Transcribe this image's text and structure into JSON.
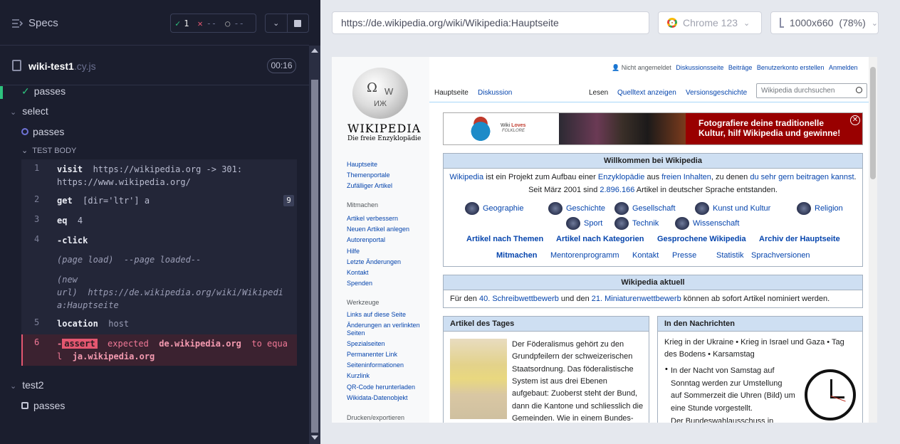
{
  "left": {
    "specs_label": "Specs",
    "stats": {
      "passed": "1",
      "failed": "--",
      "pending": "--"
    },
    "file": {
      "name": "wiki-test1",
      "ext": ".cy.js",
      "duration": "00:16"
    },
    "tests": [
      {
        "label": "passes"
      },
      {
        "label": "select"
      },
      {
        "label": "passes"
      },
      {
        "label": "TEST BODY"
      },
      {
        "label": "test2"
      },
      {
        "label": "passes"
      }
    ],
    "commands": [
      {
        "n": "1",
        "name": "visit",
        "msg": "https://wikipedia.org -> 301:\nhttps://www.wikipedia.org/"
      },
      {
        "n": "2",
        "name": "get",
        "msg": "[dir='ltr'] a",
        "badge": "9"
      },
      {
        "n": "3",
        "name": "eq",
        "msg": "4"
      },
      {
        "n": "4",
        "name": "-click",
        "msg": ""
      },
      {
        "n": "",
        "name": "(page load)",
        "msg": "--page loaded--"
      },
      {
        "n": "",
        "name": "(new\nurl)",
        "msg": "https://de.wikipedia.org/wiki/Wikipedia:Hauptseite"
      },
      {
        "n": "5",
        "name": "location",
        "msg": "host"
      },
      {
        "n": "6",
        "name": "-",
        "assert": "assert",
        "msg_a": "expected",
        "msg_b": "de.wikipedia.org",
        "msg_c": "to equal",
        "msg_d": "ja.wikipedia.org"
      }
    ]
  },
  "right": {
    "url": "https://de.wikipedia.org/wiki/Wikipedia:Hauptseite",
    "browser": "Chrome 123",
    "viewport": "1000x660",
    "zoom": "(78%)"
  },
  "wiki": {
    "logo_title": "WIKIPEDIA",
    "logo_sub": "Die freie Enzyklopädie",
    "user_links": [
      "Nicht angemeldet",
      "Diskussionsseite",
      "Beiträge",
      "Benutzerkonto erstellen",
      "Anmelden"
    ],
    "tabs_left": [
      "Hauptseite",
      "Diskussion"
    ],
    "tabs_right": [
      "Lesen",
      "Quelltext anzeigen",
      "Versionsgeschichte"
    ],
    "search_placeholder": "Wikipedia durchsuchen",
    "nav_main": [
      "Hauptseite",
      "Themenportale",
      "Zufälliger Artikel"
    ],
    "nav_mitmachen_head": "Mitmachen",
    "nav_mitmachen": [
      "Artikel verbessern",
      "Neuen Artikel anlegen",
      "Autorenportal",
      "Hilfe",
      "Letzte Änderungen",
      "Kontakt",
      "Spenden"
    ],
    "nav_werkzeuge_head": "Werkzeuge",
    "nav_werkzeuge": [
      "Links auf diese Seite",
      "Änderungen an verlinkten Seiten",
      "Spezialseiten",
      "Permanenter Link",
      "Seiteninformationen",
      "Kurzlink",
      "QR-Code herunterladen",
      "Wikidata-Datenobjekt"
    ],
    "nav_drucken_head": "Drucken/exportieren",
    "banner_brand_a": "Wiki",
    "banner_brand_b": "Loves",
    "banner_brand_c": "FOLKLORE",
    "banner_text": "Fotografiere deine traditionelle Kultur, hilf Wikipedia und gewinne!",
    "welcome_title": "Willkommen bei Wikipedia",
    "welcome_l1_a": "Wikipedia",
    "welcome_l1_b": " ist ein Projekt zum Aufbau einer ",
    "welcome_l1_c": "Enzyklopädie",
    "welcome_l1_d": " aus ",
    "welcome_l1_e": "freien Inhalten",
    "welcome_l1_f": ", zu denen ",
    "welcome_l1_g": "du sehr gern beitragen kannst",
    "welcome_l1_h": ".",
    "welcome_l2_a": "Seit März 2001 sind ",
    "welcome_l2_b": "2.896.166",
    "welcome_l2_c": " Artikel in deutscher Sprache entstanden.",
    "portals": [
      "Geographie",
      "Geschichte",
      "Gesellschaft",
      "Kunst und Kultur",
      "Religion",
      "Sport",
      "Technik",
      "Wissenschaft"
    ],
    "links_row1": [
      "Artikel nach Themen",
      "Artikel nach Kategorien",
      "Gesprochene Wikipedia",
      "Archiv der Hauptseite"
    ],
    "links_row2": [
      "Mitmachen",
      "Mentorenprogramm",
      "Kontakt",
      "Presse",
      "Statistik",
      "Sprachversionen"
    ],
    "aktuell_title": "Wikipedia aktuell",
    "aktuell_a": "Für den ",
    "aktuell_b": "40. Schreibwettbewerb",
    "aktuell_c": " und den ",
    "aktuell_d": "21. Miniaturenwettbewerb",
    "aktuell_e": " können ab sofort Artikel nominiert werden.",
    "tages_title": "Artikel des Tages",
    "tages_lines": [
      "Der Föderalismus gehört zu den",
      "Grundpfeilern der schweizerischen",
      "Staatsordnung. Das föderalistische",
      "System ist aus drei Ebenen",
      "aufgebaut: Zuoberst steht der Bund,",
      "dann die Kantone und schliesslich die",
      "Gemeinden. Wie in einem Bundes-"
    ],
    "news_title": "In den Nachrichten",
    "news_links_1": "Krieg in der Ukraine • Krieg in Israel und Gaza • Tag",
    "news_links_2": "des Bodens • Karsamstag",
    "news_lines": [
      "In der Nacht von Samstag auf",
      "Sonntag werden zur Umstellung",
      "auf Sommerzeit die Uhren (Bild) um",
      "eine Stunde vorgestellt."
    ],
    "news_last": "Der Bundeswahlausschuss in"
  }
}
